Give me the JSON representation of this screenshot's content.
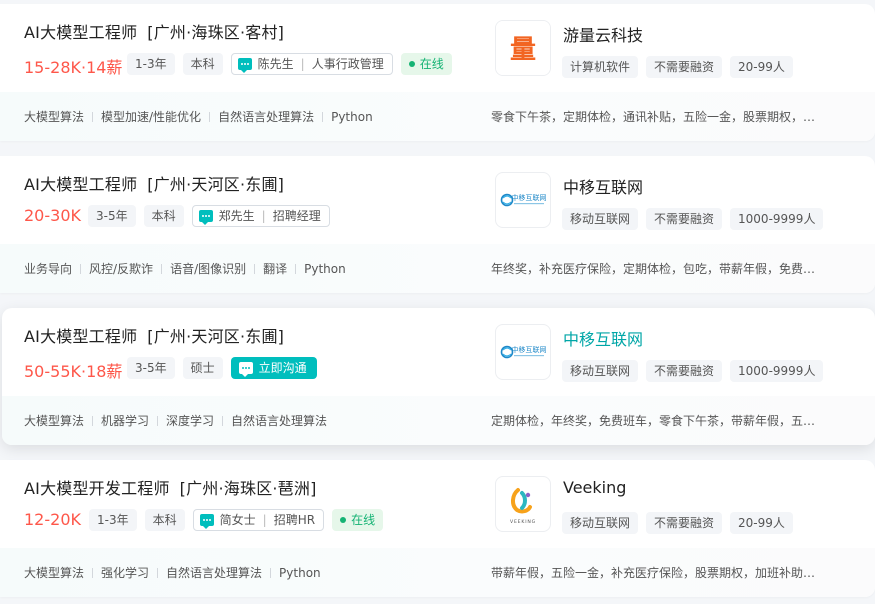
{
  "jobs": [
    {
      "title": "AI大模型工程师",
      "area": "[广州·海珠区·客村]",
      "salary": "15-28K·14薪",
      "experience": "1-3年",
      "degree": "本科",
      "recruiter_name": "陈先生",
      "recruiter_title": "人事行政管理",
      "status": "在线",
      "skills": [
        "大模型算法",
        "模型加速/性能优化",
        "自然语言处理算法",
        "Python"
      ],
      "company_name": "游量云科技",
      "company_tags": [
        "计算机软件",
        "不需要融资",
        "20-99人"
      ],
      "welfare": "零食下午茶，定期体检，通讯补贴，五险一金，股票期权，…",
      "logo_icon": "youliang-logo"
    },
    {
      "title": "AI大模型工程师",
      "area": "[广州·天河区·东圃]",
      "salary": "20-30K",
      "experience": "3-5年",
      "degree": "本科",
      "recruiter_name": "郑先生",
      "recruiter_title": "招聘经理",
      "status": "",
      "skills": [
        "业务导向",
        "风控/反欺诈",
        "语音/图像识别",
        "翻译",
        "Python"
      ],
      "company_name": "中移互联网",
      "company_tags": [
        "移动互联网",
        "不需要融资",
        "1000-9999人"
      ],
      "welfare": "年终奖，补充医疗保险，定期体检，包吃，带薪年假，免费…",
      "logo_icon": "china-mobile-internet-logo"
    },
    {
      "title": "AI大模型工程师",
      "area": "[广州·天河区·东圃]",
      "salary": "50-55K·18薪",
      "experience": "3-5年",
      "degree": "硕士",
      "chat_label": "立即沟通",
      "skills": [
        "大模型算法",
        "机器学习",
        "深度学习",
        "自然语言处理算法"
      ],
      "company_name": "中移互联网",
      "company_tags": [
        "移动互联网",
        "不需要融资",
        "1000-9999人"
      ],
      "welfare": "定期体检，年终奖，免费班车，零食下午茶，带薪年假，五…",
      "logo_icon": "china-mobile-internet-logo"
    },
    {
      "title": "AI大模型开发工程师",
      "area": "[广州·海珠区·琶洲]",
      "salary": "12-20K",
      "experience": "1-3年",
      "degree": "本科",
      "recruiter_name": "简女士",
      "recruiter_title": "招聘HR",
      "status": "在线",
      "skills": [
        "大模型算法",
        "强化学习",
        "自然语言处理算法",
        "Python"
      ],
      "company_name": "Veeking",
      "company_tags": [
        "移动互联网",
        "不需要融资",
        "20-99人"
      ],
      "welfare": "带薪年假，五险一金，补充医疗保险，股票期权，加班补助…",
      "logo_icon": "veeking-logo",
      "logo_text": "VEEKING"
    }
  ],
  "logos": {
    "youliang_char": "量",
    "cmi_text": "中移互联网"
  },
  "colors": {
    "salary": "#fe574a",
    "accent": "#00bebd",
    "online": "#15b374",
    "highlight_company": "#00a6a7"
  }
}
